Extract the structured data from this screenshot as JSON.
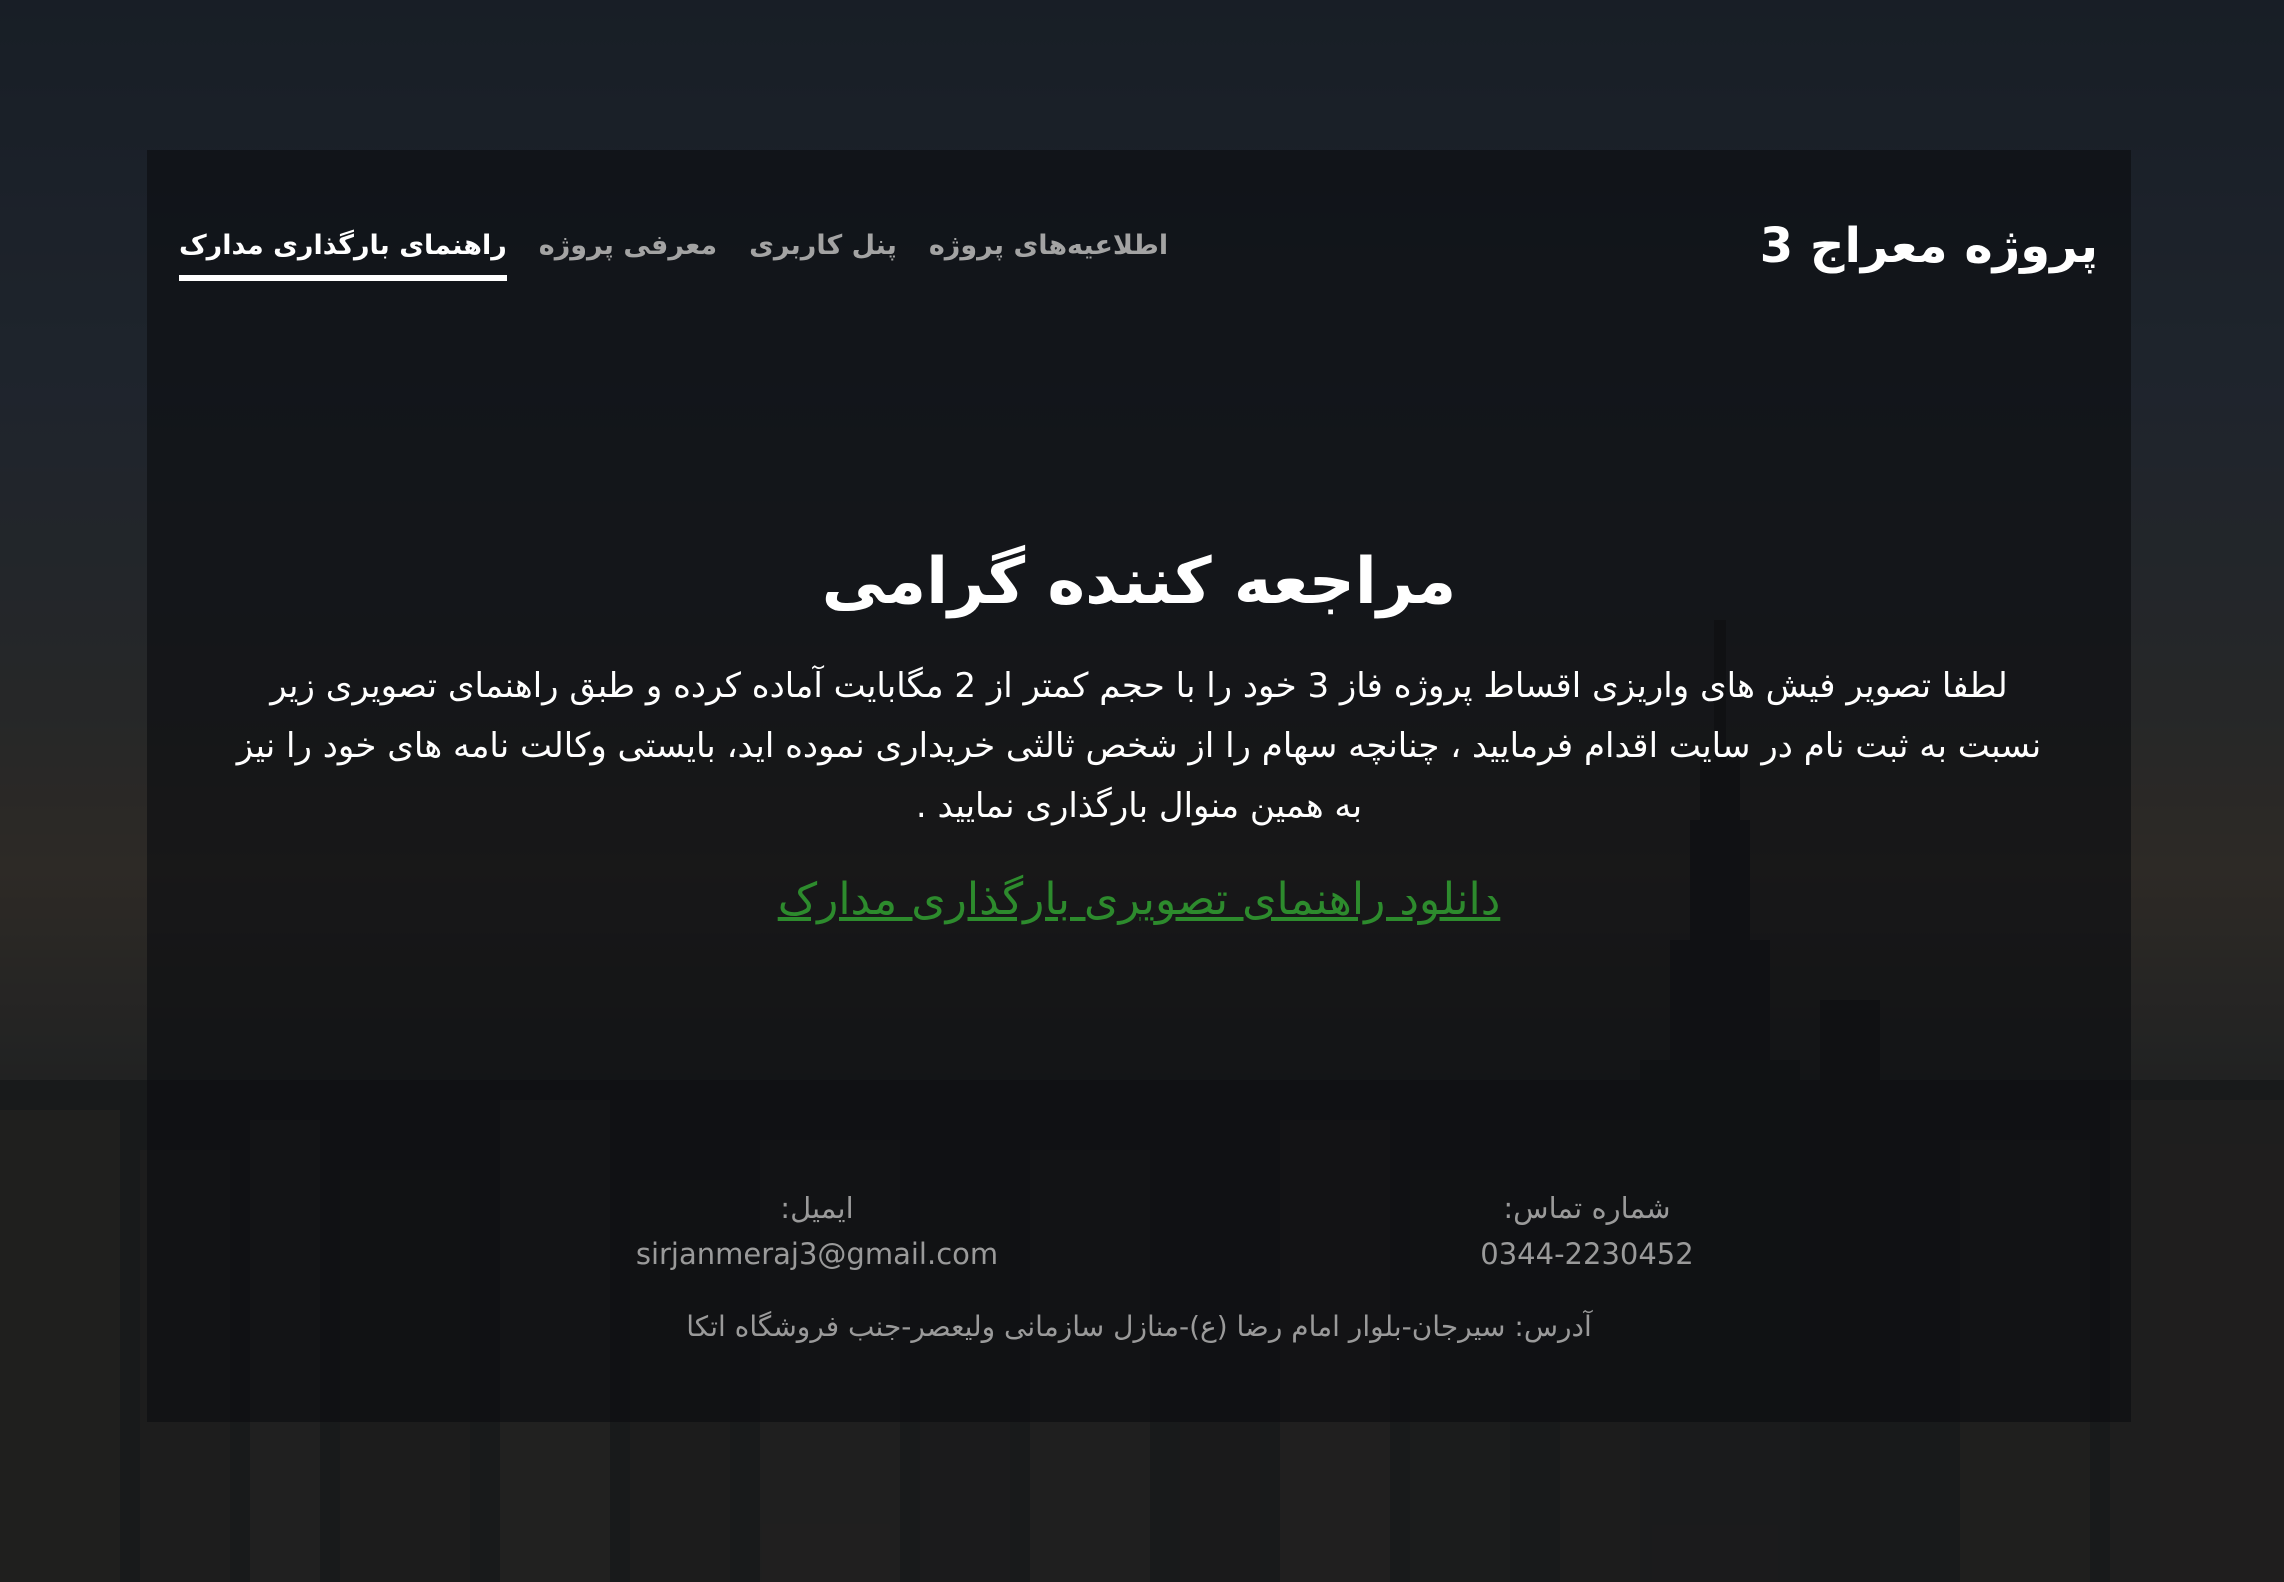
{
  "header": {
    "site_title": "پروژه معراج 3",
    "nav": [
      {
        "label": "راهنمای بارگذاری مدارک",
        "active": true
      },
      {
        "label": "معرفی پروژه",
        "active": false
      },
      {
        "label": "پنل کاربری",
        "active": false
      },
      {
        "label": "اطلاعیه‌های پروژه",
        "active": false
      }
    ]
  },
  "main": {
    "heading": "مراجعه کننده گرامی",
    "body": "لطفا تصویر فیش های واریزی اقساط پروژه فاز 3 خود را با حجم کمتر از 2 مگابایت آماده کرده و طبق راهنمای تصویری زیر نسبت به ثبت نام در سایت اقدام فرمایید ، چنانچه سهام را از شخص ثالثی خریداری نموده اید، بایستی وکالت نامه های خود را نیز به همین منوال بارگذاری نمایید .",
    "download_link": "دانلود راهنمای تصویری بارگذاری مدارک"
  },
  "footer": {
    "phone_label": "شماره تماس:",
    "phone_value": "0344-2230452",
    "email_label": "ایمیل:",
    "email_value": "sirjanmeraj3@gmail.com",
    "address_label": "آدرس:",
    "address_value": "سیرجان-بلوار امام رضا (ع)-منازل سازمانی ولیعصر-جنب فروشگاه اتکا"
  },
  "colors": {
    "link": "#2d8b2d",
    "text": "#ffffff",
    "muted": "#9a9a9a"
  }
}
